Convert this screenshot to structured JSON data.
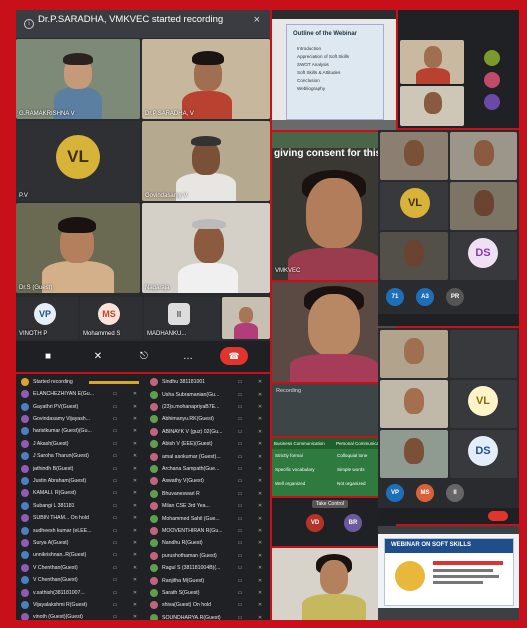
{
  "toast": {
    "title": "Dr.P.SARADHA, VMKVEC started recording",
    "close": "×"
  },
  "left_grid": {
    "tiles": [
      {
        "label": "G.RAMAKRISHNA V"
      },
      {
        "label": "Dr.P.SARADHA, V"
      },
      {
        "label": "P.V",
        "avatar": "VL",
        "avatar_color": "#b8a02c"
      },
      {
        "label": "Govindasamy V"
      },
      {
        "label": "Dr.S (Guest)"
      },
      {
        "label": "Nagaraja"
      }
    ],
    "bottom_chips": [
      {
        "avatar": "VP",
        "label": "VINOTH P",
        "color": "#1f6fb8"
      },
      {
        "avatar": "MS",
        "label": "Mohammed S",
        "color": "#d8613c"
      },
      {
        "avatar": "II",
        "label": "MADHANKU...",
        "color": "#666"
      }
    ]
  },
  "controls": {
    "camera": "■",
    "mic": "✕",
    "present": "⎋",
    "more": "…",
    "end": "☎"
  },
  "participants_left": {
    "header": "Started recording",
    "rows": [
      "ELANCHEZHIYAN E(Gu...",
      "Gayathri PV(Guest)",
      "Govindasamy Vijayash...",
      "haristkumar (Guest)(Gu...",
      "J Akash(Guest)",
      "J Saroha Tharun(Guest)",
      "jathindh B(Guest)",
      "Justin Abraham(Guest)",
      "KAMALI. R(Guest)",
      "Subangi L 381181",
      "SUBIN THAM...   On hold",
      "sudheesh kumar (eLEE...",
      "Surya A(Guest)",
      "unnikrishnan..R(Guest)",
      "V Chenthan(Guest)",
      "V Chenthan(Guest)",
      "v.sathish(381181007...",
      "Vijayalakshmi R(Guest)",
      "vinoth (Guest)(Guest)"
    ]
  },
  "participants_right": {
    "rows": [
      "Sindhu 381181001",
      "Usha Subramanian(Gu...",
      "(23)s.mohanapriyaB7E...",
      "Abhimanyu.RK(Guest)",
      "ABINAYK V (guz) 02(Gu...",
      "Abish V (EEE)(Guest)",
      "amal asokumar (Guest)...",
      "Archana Sampath(Gue...",
      "Aswathy V(Guest)",
      "Bhuvaneswari R",
      "Milan CSE 3rd Yea...",
      "Mohammed Sahil (Gue...",
      "MOOVENTHIRAN R(Gu...",
      "Nandhu R(Guest)",
      "purushothaman (Guest)",
      "Ragul S (381181004B)(...",
      "Ranjitha M(Guest)",
      "Sarath S(Guest)",
      "shiva(Guest)   On hold",
      "SOUNDHARYA.R(Guest)"
    ]
  },
  "middle": {
    "slide_title": "Outline of the Webinar",
    "slide_items": [
      "Introduction",
      "Appreciation of Soft Skills",
      "SWOT Analysis",
      "Soft Skills & Attitudes",
      "Conclusion",
      "Webliography"
    ],
    "consent_text": "giving consent for this me",
    "name_chip": "VMKVEC",
    "recording": "Recording",
    "table_headers": [
      "Business Communication",
      "Personal Communication"
    ],
    "table_rows": [
      [
        "Strictly formal",
        "Colloquial tone"
      ],
      [
        "Specific vocabulary",
        "Simple words"
      ],
      [
        "Well organized",
        "Not organized"
      ]
    ],
    "table_control": "Take Control",
    "mini_avatars": [
      "VD",
      "BR"
    ]
  },
  "right_col": {
    "avatars": [
      {
        "text": "VL",
        "color": "#b8a02c"
      },
      {
        "text": "DS",
        "color": "#8b3aa8"
      },
      {
        "text": "VL",
        "color": "#b8a02c"
      },
      {
        "text": "DS",
        "color": "#1f6fb8"
      }
    ],
    "chips": [
      "71",
      "A3",
      "PR"
    ],
    "chips2": [
      "VP",
      "MS",
      "II"
    ],
    "banner_title": "WEBINAR ON SOFT SKILLS"
  }
}
